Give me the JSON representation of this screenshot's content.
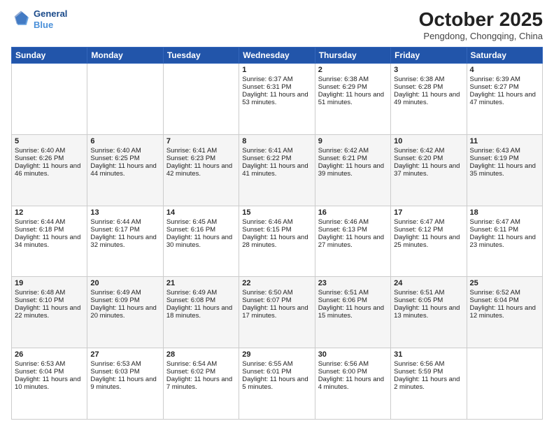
{
  "header": {
    "logo_line1": "General",
    "logo_line2": "Blue",
    "month_title": "October 2025",
    "location": "Pengdong, Chongqing, China"
  },
  "days_of_week": [
    "Sunday",
    "Monday",
    "Tuesday",
    "Wednesday",
    "Thursday",
    "Friday",
    "Saturday"
  ],
  "weeks": [
    [
      {
        "day": "",
        "content": ""
      },
      {
        "day": "",
        "content": ""
      },
      {
        "day": "",
        "content": ""
      },
      {
        "day": "1",
        "content": "Sunrise: 6:37 AM\nSunset: 6:31 PM\nDaylight: 11 hours and 53 minutes."
      },
      {
        "day": "2",
        "content": "Sunrise: 6:38 AM\nSunset: 6:29 PM\nDaylight: 11 hours and 51 minutes."
      },
      {
        "day": "3",
        "content": "Sunrise: 6:38 AM\nSunset: 6:28 PM\nDaylight: 11 hours and 49 minutes."
      },
      {
        "day": "4",
        "content": "Sunrise: 6:39 AM\nSunset: 6:27 PM\nDaylight: 11 hours and 47 minutes."
      }
    ],
    [
      {
        "day": "5",
        "content": "Sunrise: 6:40 AM\nSunset: 6:26 PM\nDaylight: 11 hours and 46 minutes."
      },
      {
        "day": "6",
        "content": "Sunrise: 6:40 AM\nSunset: 6:25 PM\nDaylight: 11 hours and 44 minutes."
      },
      {
        "day": "7",
        "content": "Sunrise: 6:41 AM\nSunset: 6:23 PM\nDaylight: 11 hours and 42 minutes."
      },
      {
        "day": "8",
        "content": "Sunrise: 6:41 AM\nSunset: 6:22 PM\nDaylight: 11 hours and 41 minutes."
      },
      {
        "day": "9",
        "content": "Sunrise: 6:42 AM\nSunset: 6:21 PM\nDaylight: 11 hours and 39 minutes."
      },
      {
        "day": "10",
        "content": "Sunrise: 6:42 AM\nSunset: 6:20 PM\nDaylight: 11 hours and 37 minutes."
      },
      {
        "day": "11",
        "content": "Sunrise: 6:43 AM\nSunset: 6:19 PM\nDaylight: 11 hours and 35 minutes."
      }
    ],
    [
      {
        "day": "12",
        "content": "Sunrise: 6:44 AM\nSunset: 6:18 PM\nDaylight: 11 hours and 34 minutes."
      },
      {
        "day": "13",
        "content": "Sunrise: 6:44 AM\nSunset: 6:17 PM\nDaylight: 11 hours and 32 minutes."
      },
      {
        "day": "14",
        "content": "Sunrise: 6:45 AM\nSunset: 6:16 PM\nDaylight: 11 hours and 30 minutes."
      },
      {
        "day": "15",
        "content": "Sunrise: 6:46 AM\nSunset: 6:15 PM\nDaylight: 11 hours and 28 minutes."
      },
      {
        "day": "16",
        "content": "Sunrise: 6:46 AM\nSunset: 6:13 PM\nDaylight: 11 hours and 27 minutes."
      },
      {
        "day": "17",
        "content": "Sunrise: 6:47 AM\nSunset: 6:12 PM\nDaylight: 11 hours and 25 minutes."
      },
      {
        "day": "18",
        "content": "Sunrise: 6:47 AM\nSunset: 6:11 PM\nDaylight: 11 hours and 23 minutes."
      }
    ],
    [
      {
        "day": "19",
        "content": "Sunrise: 6:48 AM\nSunset: 6:10 PM\nDaylight: 11 hours and 22 minutes."
      },
      {
        "day": "20",
        "content": "Sunrise: 6:49 AM\nSunset: 6:09 PM\nDaylight: 11 hours and 20 minutes."
      },
      {
        "day": "21",
        "content": "Sunrise: 6:49 AM\nSunset: 6:08 PM\nDaylight: 11 hours and 18 minutes."
      },
      {
        "day": "22",
        "content": "Sunrise: 6:50 AM\nSunset: 6:07 PM\nDaylight: 11 hours and 17 minutes."
      },
      {
        "day": "23",
        "content": "Sunrise: 6:51 AM\nSunset: 6:06 PM\nDaylight: 11 hours and 15 minutes."
      },
      {
        "day": "24",
        "content": "Sunrise: 6:51 AM\nSunset: 6:05 PM\nDaylight: 11 hours and 13 minutes."
      },
      {
        "day": "25",
        "content": "Sunrise: 6:52 AM\nSunset: 6:04 PM\nDaylight: 11 hours and 12 minutes."
      }
    ],
    [
      {
        "day": "26",
        "content": "Sunrise: 6:53 AM\nSunset: 6:04 PM\nDaylight: 11 hours and 10 minutes."
      },
      {
        "day": "27",
        "content": "Sunrise: 6:53 AM\nSunset: 6:03 PM\nDaylight: 11 hours and 9 minutes."
      },
      {
        "day": "28",
        "content": "Sunrise: 6:54 AM\nSunset: 6:02 PM\nDaylight: 11 hours and 7 minutes."
      },
      {
        "day": "29",
        "content": "Sunrise: 6:55 AM\nSunset: 6:01 PM\nDaylight: 11 hours and 5 minutes."
      },
      {
        "day": "30",
        "content": "Sunrise: 6:56 AM\nSunset: 6:00 PM\nDaylight: 11 hours and 4 minutes."
      },
      {
        "day": "31",
        "content": "Sunrise: 6:56 AM\nSunset: 5:59 PM\nDaylight: 11 hours and 2 minutes."
      },
      {
        "day": "",
        "content": ""
      }
    ]
  ]
}
